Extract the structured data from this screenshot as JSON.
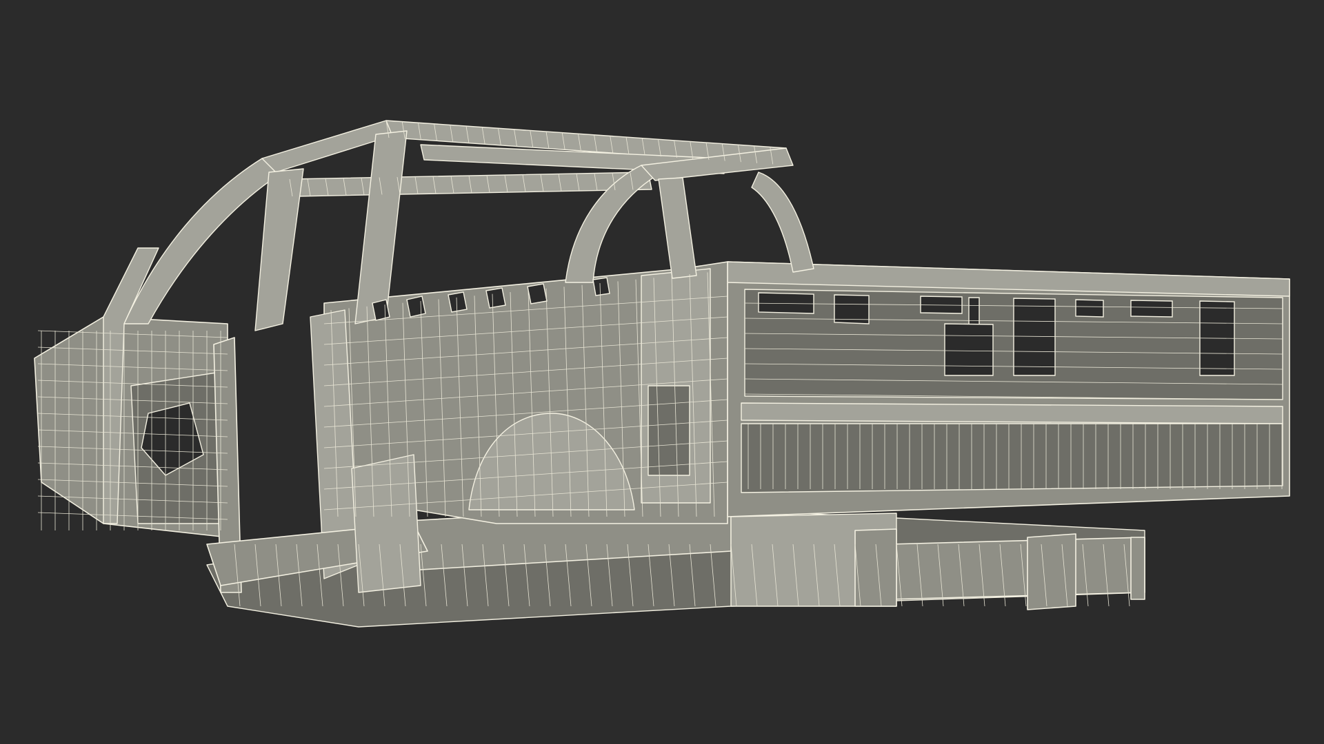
{
  "scene": {
    "background_color": "#2b2b2b",
    "mesh_line_color": "#f2efe0",
    "panel_color": "#8f8f86",
    "subject": "pickup-truck-body-frame-wireframe"
  }
}
